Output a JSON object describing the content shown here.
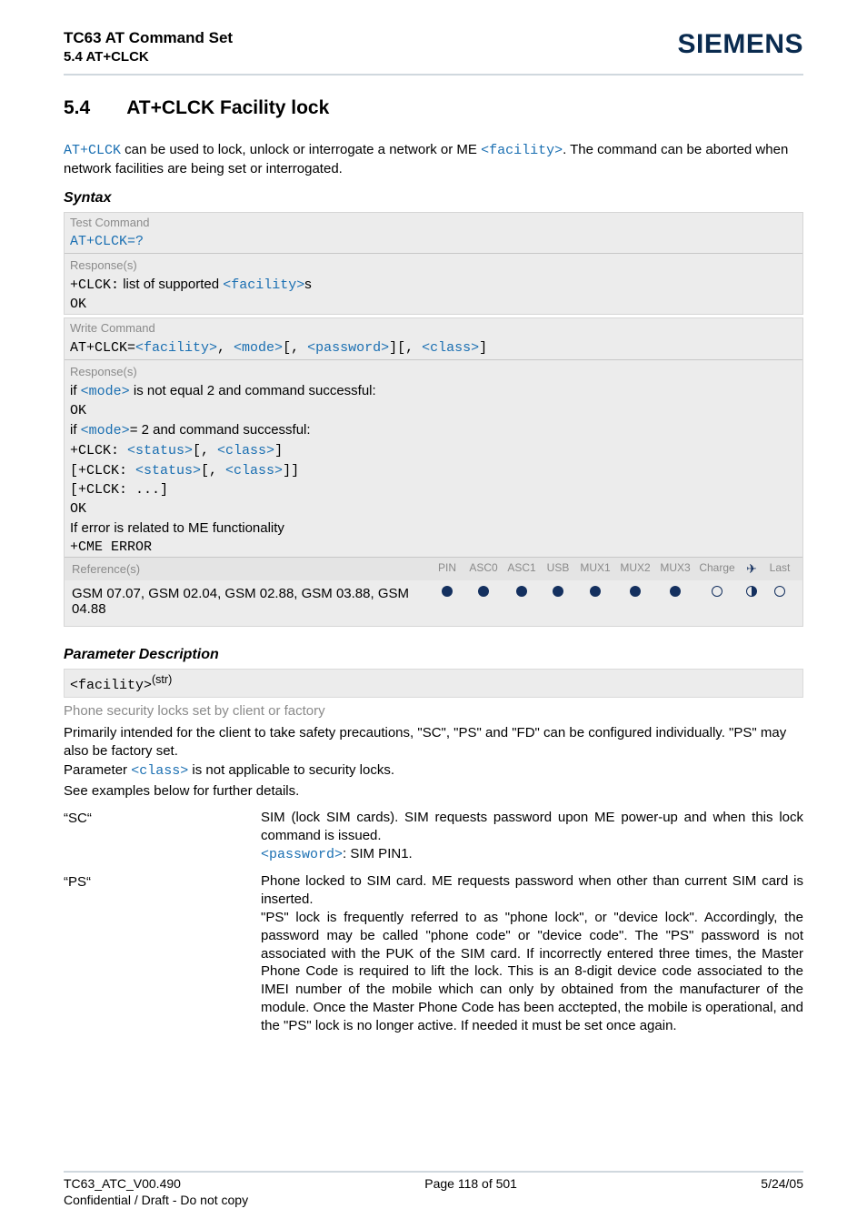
{
  "header": {
    "title": "TC63 AT Command Set",
    "subtitle": "5.4 AT+CLCK",
    "brand": "SIEMENS"
  },
  "section": {
    "number": "5.4",
    "title": "AT+CLCK   Facility lock"
  },
  "intro": {
    "cmd": "AT+CLCK",
    "pre": " can be used to lock, unlock or interrogate a network or ME ",
    "facility": "<facility>",
    "post": ". The command can be aborted when network facilities are being set or interrogated."
  },
  "syntax_label": "Syntax",
  "test_command": {
    "label": "Test Command",
    "cmd": "AT+CLCK=?",
    "resp_label": "Response(s)",
    "resp_prefix": "+CLCK:",
    "resp_text": "list of supported ",
    "resp_facility": "<facility>",
    "resp_suffix": "s",
    "ok": "OK"
  },
  "write_command": {
    "label": "Write Command",
    "cmd_prefix": "AT+CLCK=",
    "p_facility": "<facility>",
    "p_mode": "<mode>",
    "p_password": "<password>",
    "p_class": "<class>",
    "resp_label": "Response(s)",
    "l1a": "if ",
    "l1b": " is not equal 2 and command successful:",
    "ok": "OK",
    "l2a": "if ",
    "l2b": "= 2 and command successful:",
    "l3_prefix": "+CLCK: ",
    "status": "<status>",
    "l5_prefix": "[+CLCK: ",
    "l5_suffix": "]]",
    "l6": "[+CLCK: ...]",
    "err1": "If error is related to ME functionality",
    "err2": "+CME ERROR"
  },
  "matrix": {
    "ref_label": "Reference(s)",
    "refs": "GSM 07.07, GSM 02.04, GSM 02.88, GSM 03.88, GSM 04.88",
    "cols": [
      "PIN",
      "ASC0",
      "ASC1",
      "USB",
      "MUX1",
      "MUX2",
      "MUX3",
      "Charge",
      "✈",
      "Last"
    ]
  },
  "paramdesc_label": "Parameter Description",
  "param_facility": {
    "tag": "<facility>",
    "sup": "(str)",
    "subline": "Phone security locks set by client or factory",
    "p1": "Primarily intended for the client to take safety precautions, \"SC\", \"PS\" and \"FD\" can be configured individually. \"PS\" may also be factory set.",
    "p2a": "Parameter ",
    "p2_class": "<class>",
    "p2b": " is not applicable to security locks.",
    "p3": "See examples below for further details."
  },
  "defs": {
    "sc_term": "“SC“",
    "sc_def_a": "SIM (lock SIM cards). SIM requests password upon ME power-up and when this lock command is issued.",
    "sc_pw_label": "<password>",
    "sc_pw_val": ": SIM PIN1.",
    "ps_term": "“PS“",
    "ps_def": "Phone locked to SIM card. ME requests password when other than current SIM card is inserted.\n\"PS\" lock is frequently referred to as \"phone lock\", or \"device lock\". Accordingly, the password may be called \"phone code\" or \"device code\". The \"PS\" password is not associated with the PUK of the SIM card. If incorrectly entered three times, the Master Phone Code is required to lift the lock. This is an 8-digit device code associated to the IMEI number of the mobile which can only by obtained from the manufacturer of the module. Once the Master Phone Code has been acctepted, the mobile is operational, and the \"PS\" lock is no longer active. If needed it must be set once again."
  },
  "footer": {
    "left": "TC63_ATC_V00.490",
    "center": "Page 118 of 501",
    "right": "5/24/05",
    "sub": "Confidential / Draft - Do not copy"
  }
}
